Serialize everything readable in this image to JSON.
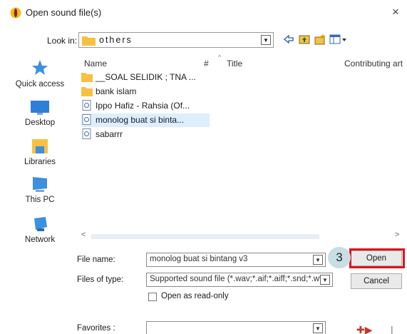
{
  "window": {
    "title": "Open sound file(s)",
    "close_glyph": "×"
  },
  "look_in": {
    "label": "Look in:",
    "value": "others"
  },
  "places": [
    {
      "label": "Quick access",
      "icon": "star-icon"
    },
    {
      "label": "Desktop",
      "icon": "desktop-icon"
    },
    {
      "label": "Libraries",
      "icon": "libraries-icon"
    },
    {
      "label": "This PC",
      "icon": "this-pc-icon"
    },
    {
      "label": "Network",
      "icon": "network-icon"
    }
  ],
  "columns": {
    "name": "Name",
    "number": "#",
    "title": "Title",
    "artist": "Contributing art"
  },
  "files": [
    {
      "name": "__SOAL SELIDIK ; TNA ...",
      "type": "folder"
    },
    {
      "name": "bank islam",
      "type": "folder"
    },
    {
      "name": "Ippo Hafiz - Rahsia (Of...",
      "type": "audio"
    },
    {
      "name": "monolog buat si binta...",
      "type": "audio",
      "selected": true
    },
    {
      "name": "sabarrr",
      "type": "audio"
    }
  ],
  "form": {
    "file_name_label": "File name:",
    "file_name_value": "monolog buat si bintang v3",
    "file_type_label": "Files of type:",
    "file_type_value": "Supported sound file (*.wav;*.aif;*.aiff;*.snd;*.wv",
    "read_only_label": "Open as read-only",
    "favorites_label": "Favorites :"
  },
  "buttons": {
    "open": "Open",
    "cancel": "Cancel"
  },
  "step_badge": "3",
  "colors": {
    "highlight": "#e0131b",
    "folder": "#f6c143",
    "selection": "#ddeeff"
  }
}
